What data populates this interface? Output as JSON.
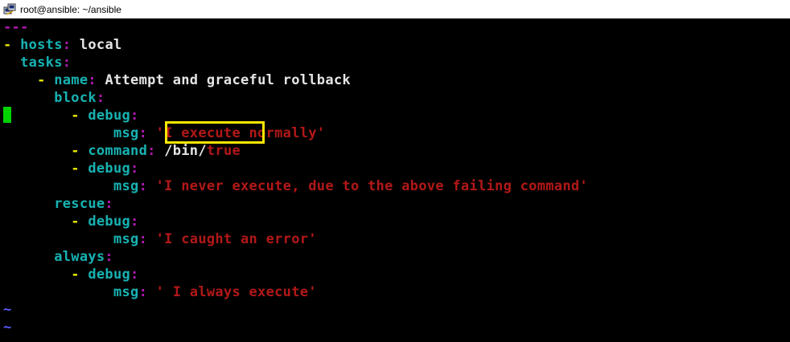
{
  "window": {
    "title": "root@ansible: ~/ansible"
  },
  "editor": {
    "lines": [
      [
        {
          "t": "---",
          "c": "magenta"
        }
      ],
      [
        {
          "t": "- ",
          "c": "yellow"
        },
        {
          "t": "hosts",
          "c": "cyan"
        },
        {
          "t": ": ",
          "c": "magenta"
        },
        {
          "t": "local",
          "c": "white"
        }
      ],
      [
        {
          "t": "  tasks",
          "c": "cyan"
        },
        {
          "t": ":",
          "c": "magenta"
        }
      ],
      [
        {
          "t": "    - ",
          "c": "yellow"
        },
        {
          "t": "name",
          "c": "cyan"
        },
        {
          "t": ": ",
          "c": "magenta"
        },
        {
          "t": "Attempt and graceful rollback",
          "c": "white"
        }
      ],
      [
        {
          "t": "      block",
          "c": "cyan"
        },
        {
          "t": ":",
          "c": "magenta"
        }
      ],
      [
        {
          "t": "        - ",
          "c": "yellow"
        },
        {
          "t": "debug",
          "c": "cyan"
        },
        {
          "t": ":",
          "c": "magenta"
        }
      ],
      [
        {
          "t": "             msg",
          "c": "cyan"
        },
        {
          "t": ": ",
          "c": "magenta"
        },
        {
          "t": "'I execute normally'",
          "c": "red"
        }
      ],
      [
        {
          "t": "        - ",
          "c": "yellow"
        },
        {
          "t": "command",
          "c": "cyan"
        },
        {
          "t": ": ",
          "c": "magenta"
        },
        {
          "t": "/bin/",
          "c": "white"
        },
        {
          "t": "true",
          "c": "red"
        }
      ],
      [
        {
          "t": "        - ",
          "c": "yellow"
        },
        {
          "t": "debug",
          "c": "cyan"
        },
        {
          "t": ":",
          "c": "magenta"
        }
      ],
      [
        {
          "t": "             msg",
          "c": "cyan"
        },
        {
          "t": ": ",
          "c": "magenta"
        },
        {
          "t": "'I never execute, due to the above failing command'",
          "c": "red"
        }
      ],
      [
        {
          "t": "      rescue",
          "c": "cyan"
        },
        {
          "t": ":",
          "c": "magenta"
        }
      ],
      [
        {
          "t": "        - ",
          "c": "yellow"
        },
        {
          "t": "debug",
          "c": "cyan"
        },
        {
          "t": ":",
          "c": "magenta"
        }
      ],
      [
        {
          "t": "             msg",
          "c": "cyan"
        },
        {
          "t": ": ",
          "c": "magenta"
        },
        {
          "t": "'I caught an error'",
          "c": "red"
        }
      ],
      [
        {
          "t": "      always",
          "c": "cyan"
        },
        {
          "t": ":",
          "c": "magenta"
        }
      ],
      [
        {
          "t": "        - ",
          "c": "yellow"
        },
        {
          "t": "debug",
          "c": "cyan"
        },
        {
          "t": ":",
          "c": "magenta"
        }
      ],
      [
        {
          "t": "             msg",
          "c": "cyan"
        },
        {
          "t": ": ",
          "c": "magenta"
        },
        {
          "t": "' I always execute'",
          "c": "red"
        }
      ],
      [
        {
          "t": "~",
          "c": "blue"
        }
      ],
      [
        {
          "t": "~",
          "c": "blue"
        }
      ]
    ]
  },
  "colors": {
    "yellow": "#e8e800",
    "cyan": "#18b2b2",
    "magenta": "#b218b2",
    "white": "#e5e5e5",
    "red": "#b21818",
    "blue": "#5c5cff",
    "cursor": "#00d200",
    "highlight": "#ffe600"
  }
}
